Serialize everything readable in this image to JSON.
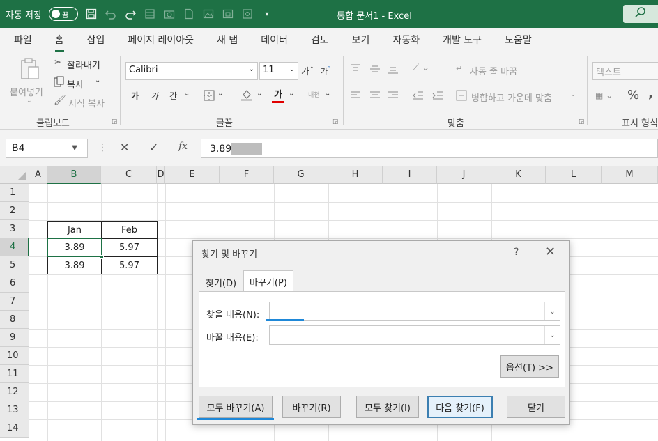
{
  "titlebar": {
    "autosave_label": "자동 저장",
    "autosave_state": "끔",
    "doc_title": "통합 문서1  -  Excel"
  },
  "ribbon_tabs": [
    "파일",
    "홈",
    "삽입",
    "페이지 레이아웃",
    "새 탭",
    "데이터",
    "검토",
    "보기",
    "자동화",
    "개발 도구",
    "도움말"
  ],
  "active_tab": "홈",
  "clipboard": {
    "paste": "붙여넣기",
    "cut": "잘라내기",
    "copy": "복사",
    "format_painter": "서식 복사",
    "group_label": "클립보드"
  },
  "font": {
    "name": "Calibri",
    "size": "11",
    "grow": "가",
    "shrink": "가",
    "bold": "가",
    "italic": "가",
    "underline": "간",
    "font_color": "가",
    "phonetic": "내천",
    "group_label": "글꼴"
  },
  "alignment": {
    "wrap_text": "자동 줄 바꿈",
    "merge_center": "병합하고 가운데 맞춤",
    "group_label": "맞춤"
  },
  "number": {
    "format": "텍스트",
    "percent": "%",
    "group_label": "표시 형식"
  },
  "formula_bar": {
    "name_box": "B4",
    "formula": "3.89"
  },
  "columns": [
    "A",
    "B",
    "C",
    "D",
    "E",
    "F",
    "G",
    "H",
    "I",
    "J",
    "K",
    "L",
    "M"
  ],
  "rows": [
    "1",
    "2",
    "3",
    "4",
    "5",
    "6",
    "7",
    "8",
    "9",
    "10",
    "11",
    "12",
    "13",
    "14"
  ],
  "cells": {
    "B3": "Jan",
    "C3": "Feb",
    "B4": "3.89",
    "C4": "5.97",
    "B5": "3.89",
    "C5": "5.97"
  },
  "dialog": {
    "title": "찾기 및 바꾸기",
    "help": "?",
    "tab_find": "찾기(D)",
    "tab_replace": "바꾸기(P)",
    "find_label": "찾을 내용(N):",
    "replace_label": "바꿀 내용(E):",
    "find_value": "",
    "replace_value": "",
    "options_button": "옵션(T) >>",
    "replace_all_button": "모두 바꾸기(A)",
    "replace_button": "바꾸기(R)",
    "find_all_button": "모두 찾기(I)",
    "find_next_button": "다음 찾기(F)",
    "close_button": "닫기"
  },
  "colors": {
    "excel_green": "#1e7145",
    "highlight_underline": "#1f88d8"
  }
}
